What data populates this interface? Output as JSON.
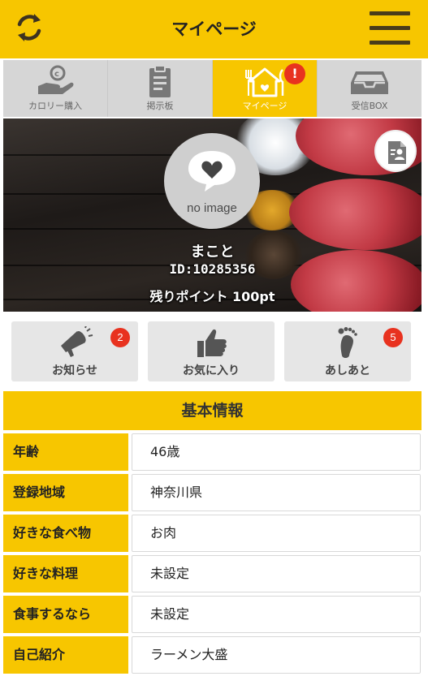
{
  "header": {
    "title": "マイページ",
    "refresh_icon": "refresh-icon",
    "menu_icon": "hamburger-menu-icon"
  },
  "tabs": [
    {
      "label": "カロリー購入",
      "icon": "coin-hand-icon",
      "active": false
    },
    {
      "label": "掲示板",
      "icon": "clipboard-icon",
      "active": false
    },
    {
      "label": "マイページ",
      "icon": "home-cutlery-icon",
      "active": true,
      "badge": "!"
    },
    {
      "label": "受信BOX",
      "icon": "inbox-tray-icon",
      "active": false
    }
  ],
  "profile": {
    "avatar_text": "no image",
    "name": "まこと",
    "id": "ID:10285356",
    "points": "残りポイント 100pt"
  },
  "actions": [
    {
      "label": "お知らせ",
      "icon": "megaphone-icon",
      "count": "2"
    },
    {
      "label": "お気に入り",
      "icon": "thumbs-up-icon",
      "count": null
    },
    {
      "label": "あしあと",
      "icon": "footprint-icon",
      "count": "5"
    }
  ],
  "basic_info": {
    "title": "基本情報",
    "rows": [
      {
        "label": "年齢",
        "value": "46歳"
      },
      {
        "label": "登録地域",
        "value": "神奈川県"
      },
      {
        "label": "好きな食べ物",
        "value": "お肉"
      },
      {
        "label": "好きな料理",
        "value": "未設定"
      },
      {
        "label": "食事するなら",
        "value": "未設定"
      },
      {
        "label": "自己紹介",
        "value": "ラーメン大盛"
      }
    ]
  },
  "colors": {
    "accent": "#f7c600",
    "badge": "#e8321f",
    "tab_inactive": "#d6d6d6"
  }
}
